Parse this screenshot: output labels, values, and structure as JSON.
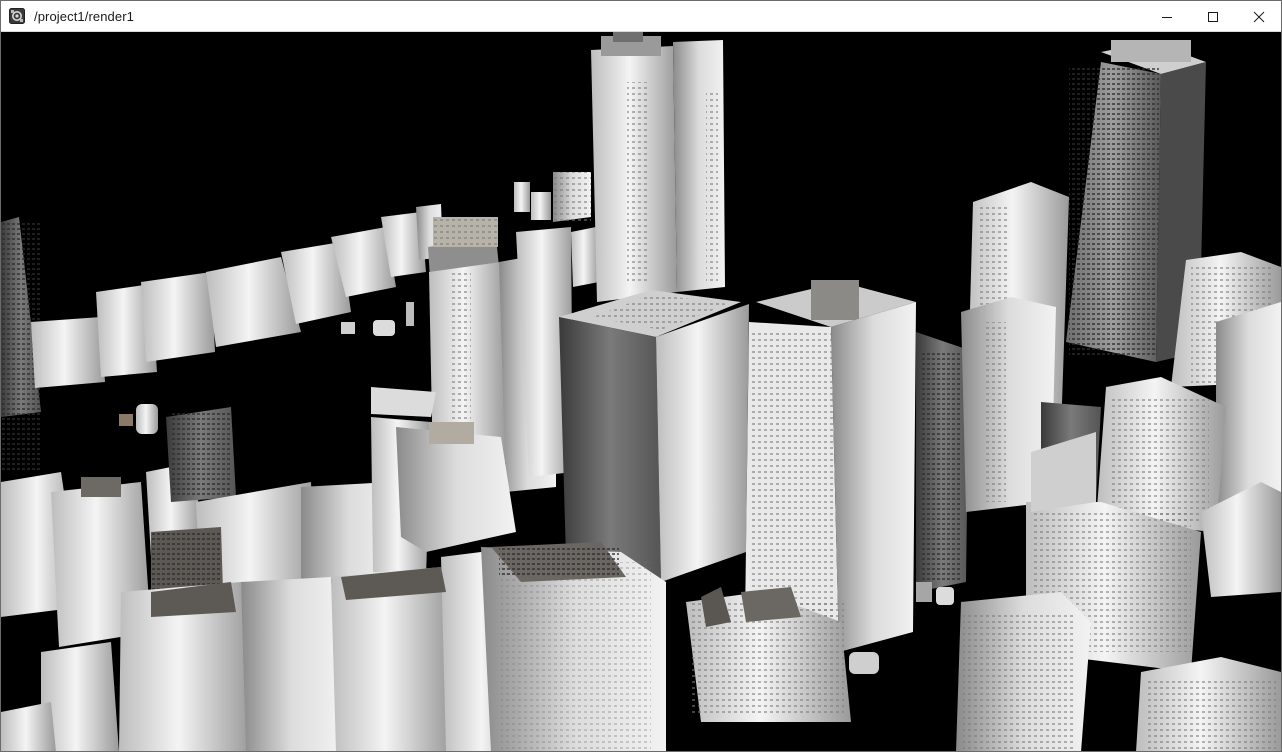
{
  "window": {
    "title": "/project1/render1",
    "app_icon": "render-app-icon",
    "controls": {
      "minimize_icon": "minimize-icon",
      "maximize_icon": "maximize-icon",
      "close_icon": "close-icon"
    }
  },
  "viewport": {
    "content": "3d-city-render",
    "background": "#000000",
    "building_light": "#e8e8e8",
    "building_mid": "#a9a9a9",
    "building_dark": "#4a4a4a"
  }
}
